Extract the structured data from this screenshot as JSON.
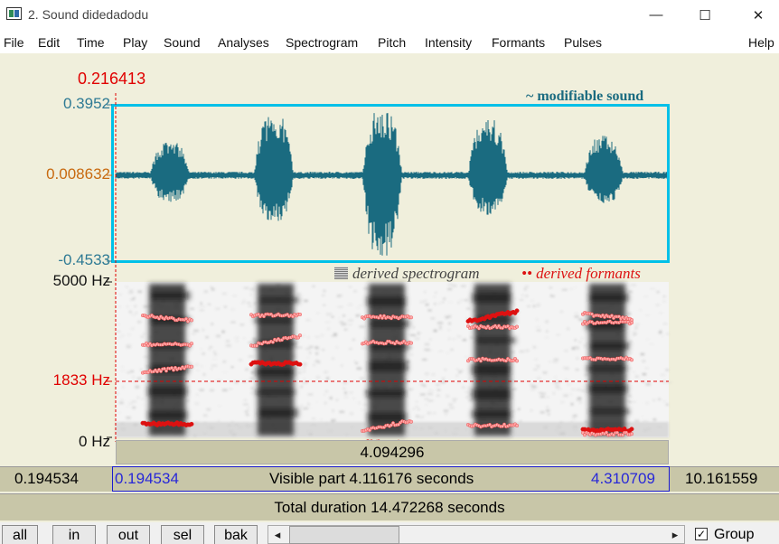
{
  "window": {
    "title": "2. Sound didedadodu",
    "controls": {
      "minimize": "—",
      "maximize": "☐",
      "close": "✕"
    }
  },
  "menu": [
    "File",
    "Edit",
    "Time",
    "Play",
    "Sound",
    "Analyses",
    "Spectrogram",
    "Pitch",
    "Intensity",
    "Formants",
    "Pulses",
    "Help"
  ],
  "cursor": {
    "time": "0.216413"
  },
  "waveform": {
    "label": "~ modifiable sound",
    "ymax": "0.3952",
    "ycursor": "0.008632",
    "ymin": "-0.4533"
  },
  "spectrogram": {
    "legend_spectrogram": "derived spectrogram",
    "legend_formants": "•• derived formants",
    "ymax": "5000 Hz",
    "ycursor": "1833 Hz",
    "ymin": "0 Hz"
  },
  "time_bars": {
    "selection_duration": "4.094296",
    "left_hidden": "0.194534",
    "visible_start": "0.194534",
    "visible_part": "Visible part 4.116176 seconds",
    "visible_end": "4.310709",
    "right_hidden": "10.161559",
    "total_duration": "Total duration 14.472268 seconds"
  },
  "buttons": {
    "all": "all",
    "in": "in",
    "out": "out",
    "sel": "sel",
    "bak": "bak"
  },
  "scrollbar": {
    "left_arrow": "◂",
    "right_arrow": "▸"
  },
  "group": {
    "label": "Group",
    "checked": true
  },
  "colors": {
    "waveform": "#1a6b80",
    "frame": "#00c0e8",
    "cursor": "#e00000",
    "axis_blue": "#2e7a94",
    "axis_orange": "#c86a10",
    "formant": "#dd1111",
    "formant_light": "#ffaaaa",
    "time_blue": "#2828d8"
  }
}
